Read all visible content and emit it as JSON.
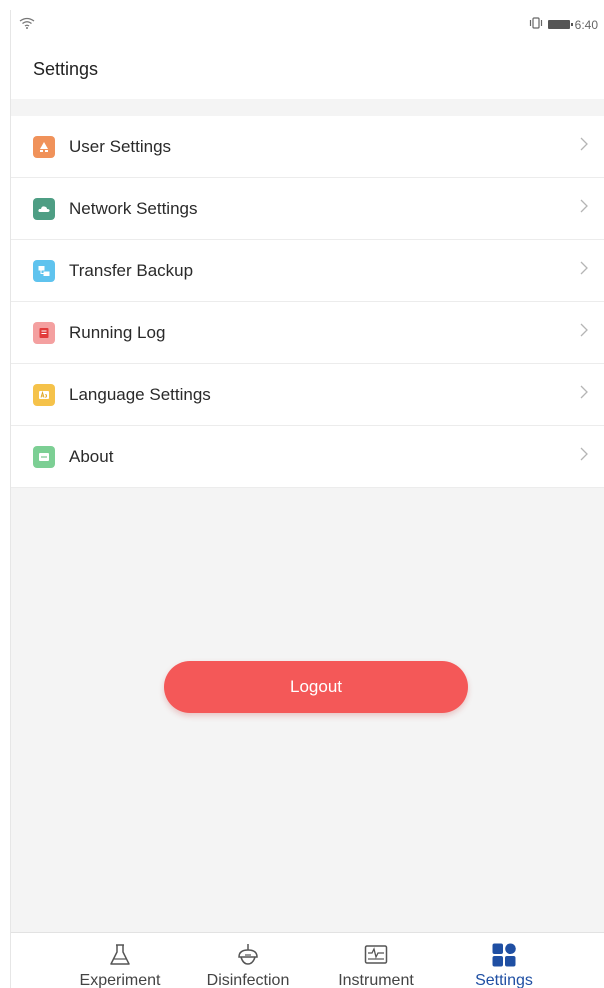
{
  "status_bar": {
    "time": "6:40",
    "icons": [
      "wifi-icon",
      "vibrate-icon",
      "battery-icon"
    ]
  },
  "header": {
    "title": "Settings"
  },
  "menu": {
    "items": [
      {
        "label": "User Settings",
        "icon": "user-settings-icon",
        "color": "#f0925a"
      },
      {
        "label": "Network Settings",
        "icon": "cloud-icon",
        "color": "#4e9e84"
      },
      {
        "label": "Transfer Backup",
        "icon": "transfer-icon",
        "color": "#5fc3ee"
      },
      {
        "label": "Running Log",
        "icon": "log-icon",
        "color": "#f4a0a0"
      },
      {
        "label": "Language Settings",
        "icon": "language-icon",
        "color": "#f5c24a"
      },
      {
        "label": "About",
        "icon": "about-icon",
        "color": "#7ccf94"
      }
    ]
  },
  "logout": {
    "label": "Logout",
    "color": "#f45858"
  },
  "tab_bar": {
    "active": "Settings",
    "active_color": "#1f4fa3",
    "tabs": [
      {
        "label": "Experiment",
        "icon": "flask-icon"
      },
      {
        "label": "Disinfection",
        "icon": "disinfection-lamp-icon"
      },
      {
        "label": "Instrument",
        "icon": "instrument-monitor-icon"
      },
      {
        "label": "Settings",
        "icon": "settings-grid-icon"
      }
    ]
  }
}
